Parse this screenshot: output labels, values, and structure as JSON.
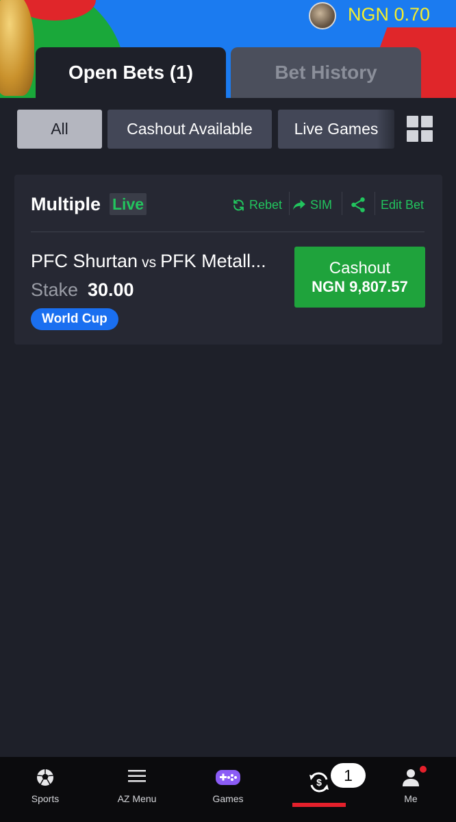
{
  "header": {
    "balance": "NGN 0.70",
    "avatar_icon": "user-avatar"
  },
  "tabs": [
    {
      "label": "Open Bets (1)",
      "active": true
    },
    {
      "label": "Bet History",
      "active": false
    }
  ],
  "filters": [
    {
      "label": "All",
      "selected": true
    },
    {
      "label": "Cashout Available",
      "selected": false
    },
    {
      "label": "Live Games",
      "selected": false
    }
  ],
  "bet": {
    "type": "Multiple",
    "status": "Live",
    "actions": {
      "rebet": "Rebet",
      "sim": "SIM",
      "edit": "Edit Bet"
    },
    "match": {
      "home": "PFC Shurtan",
      "vs": "vs",
      "away": "PFK Metall..."
    },
    "stake_label": "Stake",
    "stake_value": "30.00",
    "tag": "World Cup",
    "cashout": {
      "label": "Cashout",
      "amount": "NGN 9,807.57"
    }
  },
  "bottom_nav": {
    "sports": "Sports",
    "az_menu": "AZ Menu",
    "games": "Games",
    "open_bets_count": "1",
    "me": "Me"
  },
  "colors": {
    "background": "#1e2029",
    "accent_green": "#1fa33c",
    "balance_yellow": "#f6ee2c",
    "tag_blue": "#1a6ff0",
    "active_red": "#e5202b"
  }
}
